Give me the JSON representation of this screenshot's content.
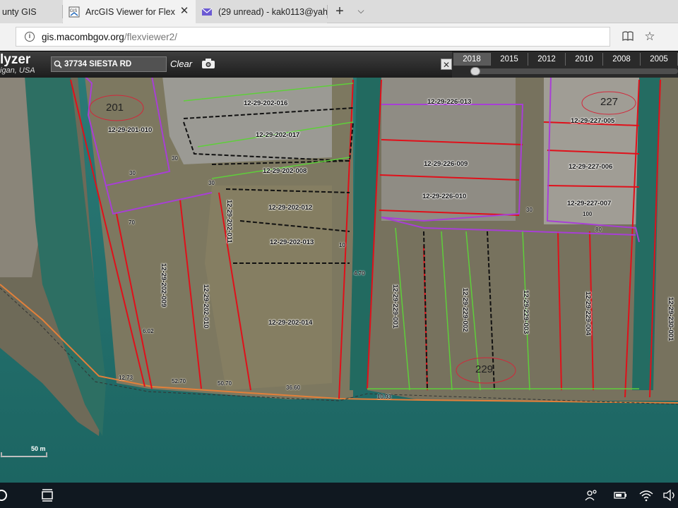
{
  "browser": {
    "tabs": [
      {
        "label": "unty GIS",
        "active": false
      },
      {
        "label": "ArcGIS Viewer for Flex",
        "active": true
      },
      {
        "label": "(29 unread) - kak0113@yah",
        "active": false
      }
    ],
    "url_domain": "gis.macombgov.org",
    "url_path": "/flexviewer2/"
  },
  "viewer": {
    "title": "lyzer",
    "subtitle": "igan, USA",
    "search_value": "37734 SIESTA RD",
    "clear_label": "Clear",
    "years": [
      "2018",
      "2015",
      "2012",
      "2010",
      "2008",
      "2005"
    ],
    "selected_year": "2018",
    "scale_label": "50 m"
  },
  "map": {
    "parcels": [
      {
        "id": "12-29-202-016"
      },
      {
        "id": "12-29-202-017"
      },
      {
        "id": "12-29-202-008"
      },
      {
        "id": "12-29-202-012"
      },
      {
        "id": "12-29-202-013"
      },
      {
        "id": "12-29-202-014"
      },
      {
        "id": "12-29-202-011"
      },
      {
        "id": "12-29-202-010"
      },
      {
        "id": "12-29-202-009"
      },
      {
        "id": "12-29-201-010"
      },
      {
        "id": "12-29-226-013"
      },
      {
        "id": "12-29-226-009"
      },
      {
        "id": "12-29-226-010"
      },
      {
        "id": "12-29-227-005"
      },
      {
        "id": "12-29-227-006"
      },
      {
        "id": "12-29-227-007"
      },
      {
        "id": "12-29-229-001"
      },
      {
        "id": "12-29-229-002"
      },
      {
        "id": "12-29-229-003"
      },
      {
        "id": "12-29-229-004"
      },
      {
        "id": "12-29-230-001"
      }
    ],
    "block_numbers": [
      "201",
      "227",
      "229"
    ],
    "dimensions": [
      "30",
      "70",
      "80",
      "100",
      "30",
      "30",
      "52.70",
      "50.70",
      "36.60",
      "12.73",
      "4.70",
      "10.93",
      "6.02",
      "30",
      "10"
    ]
  }
}
